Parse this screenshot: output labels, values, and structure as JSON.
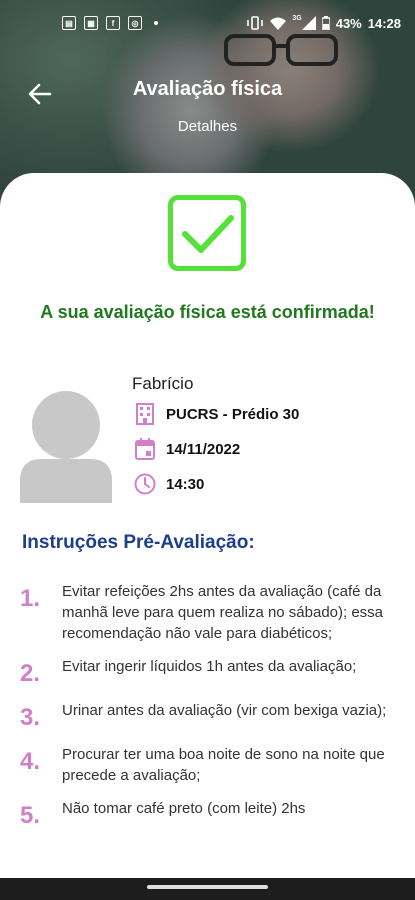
{
  "status_bar": {
    "battery": "43%",
    "time": "14:28",
    "network": "3G",
    "icons": [
      "notification-icon",
      "gallery-icon",
      "facebook-icon",
      "instagram-icon",
      "vibrate-icon",
      "wifi-icon",
      "signal-icon",
      "battery-icon"
    ]
  },
  "header": {
    "title": "Avaliação física",
    "subtitle": "Detalhes"
  },
  "confirmation": {
    "message": "A sua avaliação física está confirmada!",
    "accent_color": "#55e03a",
    "text_color": "#1f7a1f"
  },
  "details": {
    "name": "Fabrício",
    "location": "PUCRS - Prédio 30",
    "date": "14/11/2022",
    "time": "14:30",
    "icon_color": "#d17fc9"
  },
  "instructions": {
    "title": "Instruções Pré-Avaliação:",
    "items": [
      {
        "number": "1.",
        "text": "Evitar refeições 2hs antes da avaliação (café da manhã leve para quem realiza no sábado); essa recomendação não vale para diabéticos;"
      },
      {
        "number": "2.",
        "text": "Evitar ingerir líquidos 1h antes da avaliação;"
      },
      {
        "number": "3.",
        "text": "Urinar antes da avaliação (vir com bexiga vazia);"
      },
      {
        "number": "4.",
        "text": "Procurar ter uma boa noite de sono na noite que precede a avaliação;"
      },
      {
        "number": "5.",
        "text": "Não tomar café preto (com leite) 2hs"
      }
    ]
  }
}
